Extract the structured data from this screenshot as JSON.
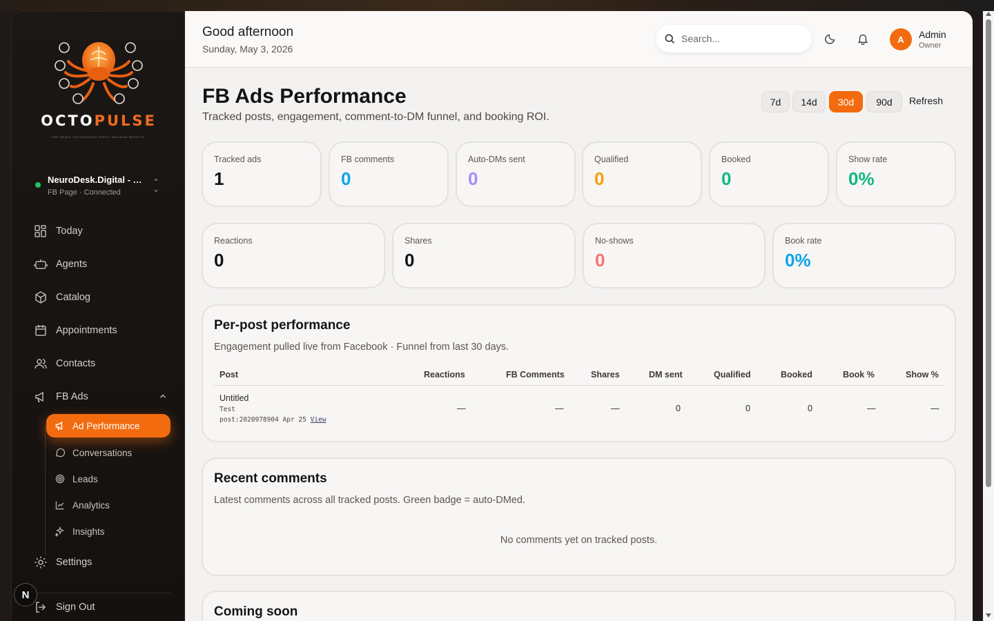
{
  "brand": {
    "name_part1": "OCTO",
    "name_part2": "PULSE",
    "tagline": "ONE BRAIN. AUTONOMOUS TASKS. MAXIMUM RESULTS.",
    "accent": "#f26b0f"
  },
  "account": {
    "name": "NeuroDesk.Digital - …",
    "status": "FB Page · Connected",
    "status_color": "#22c55e"
  },
  "nav": {
    "today": "Today",
    "agents": "Agents",
    "catalog": "Catalog",
    "appointments": "Appointments",
    "contacts": "Contacts",
    "fb_ads": "FB Ads",
    "settings": "Settings",
    "sign_out": "Sign Out"
  },
  "fb_ads_sub": {
    "ad_performance": "Ad Performance",
    "conversations": "Conversations",
    "leads": "Leads",
    "analytics": "Analytics",
    "insights": "Insights"
  },
  "badge": {
    "letter": "N"
  },
  "header": {
    "greeting": "Good afternoon",
    "date": "Sunday, May 3, 2026",
    "search_placeholder": "Search...",
    "avatar_letter": "A",
    "user_name": "Admin",
    "user_role": "Owner"
  },
  "page": {
    "title": "FB Ads Performance",
    "subtitle": "Tracked posts, engagement, comment-to-DM funnel, and booking ROI.",
    "ranges": [
      "7d",
      "14d",
      "30d",
      "90d"
    ],
    "active_range": "30d",
    "refresh": "Refresh"
  },
  "stats_row1": [
    {
      "label": "Tracked ads",
      "value": "1",
      "color": "#141414"
    },
    {
      "label": "FB comments",
      "value": "0",
      "color": "#0ea5e9"
    },
    {
      "label": "Auto-DMs sent",
      "value": "0",
      "color": "#a78bfa"
    },
    {
      "label": "Qualified",
      "value": "0",
      "color": "#f59e0b"
    },
    {
      "label": "Booked",
      "value": "0",
      "color": "#10b981"
    },
    {
      "label": "Show rate",
      "value": "0%",
      "color": "#10b981"
    }
  ],
  "stats_row2": [
    {
      "label": "Reactions",
      "value": "0",
      "color": "#141414"
    },
    {
      "label": "Shares",
      "value": "0",
      "color": "#141414"
    },
    {
      "label": "No-shows",
      "value": "0",
      "color": "#f87171"
    },
    {
      "label": "Book rate",
      "value": "0%",
      "color": "#0ea5e9"
    }
  ],
  "per_post": {
    "title": "Per-post performance",
    "desc": "Engagement pulled live from Facebook · Funnel from last 30 days.",
    "columns": [
      "Post",
      "Reactions",
      "FB Comments",
      "Shares",
      "DM sent",
      "Qualified",
      "Booked",
      "Book %",
      "Show %"
    ],
    "rows": [
      {
        "post_title": "Untitled",
        "post_sub": "Test",
        "post_meta": "post:2020978904  Apr 25",
        "view_link": "View",
        "cells": [
          "—",
          "—",
          "—",
          "0",
          "0",
          "0",
          "—",
          "—"
        ]
      }
    ]
  },
  "recent_comments": {
    "title": "Recent comments",
    "desc": "Latest comments across all tracked posts. Green badge = auto-DMed.",
    "empty": "No comments yet on tracked posts."
  },
  "coming_soon": {
    "title": "Coming soon"
  }
}
